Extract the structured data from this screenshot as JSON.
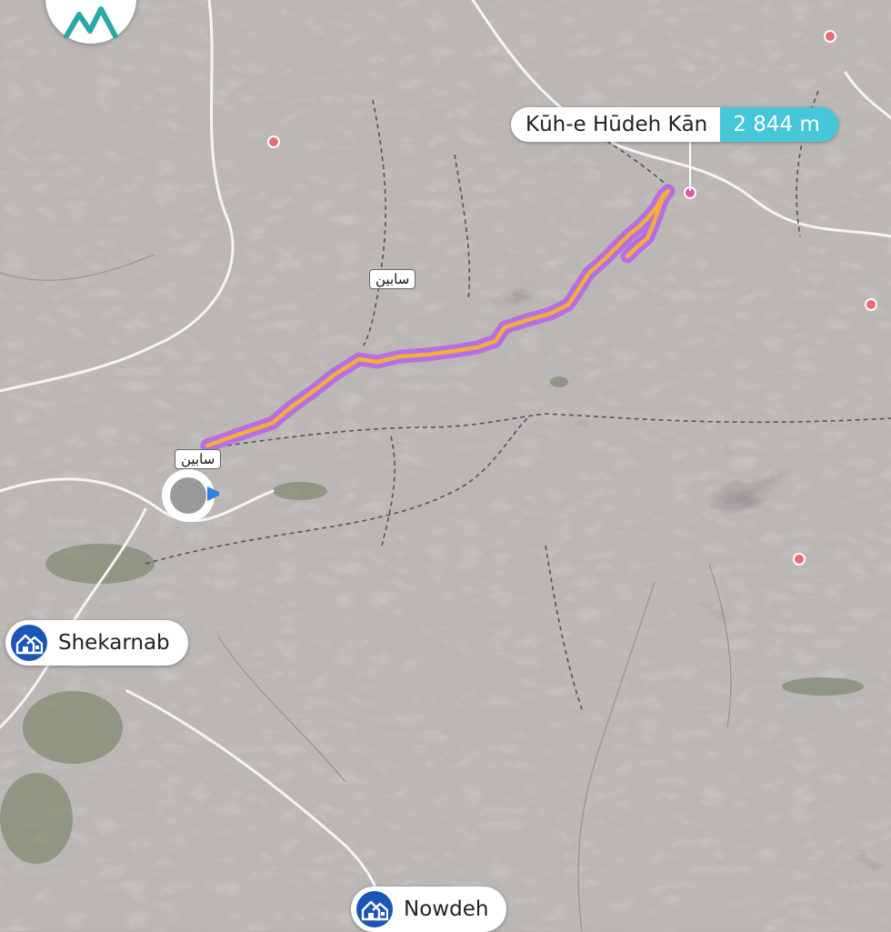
{
  "colors": {
    "terrain": "#b7b3b1",
    "route_outer": "#b56ae6",
    "route_inner": "#f2b03a",
    "elevation_badge": "#46c6d9",
    "place_icon_bg": "#1b55b7",
    "poi_dot": "#ea6b74",
    "peak_dot": "#e454a8",
    "location_arrow": "#2e7fe6",
    "location_dot": "#9a9a9a"
  },
  "app": {
    "logo_icon": "mountain-logo-icon"
  },
  "peak": {
    "name": "Kūh-e Hūdeh Kān",
    "elevation": "2 844 m"
  },
  "villages": [
    {
      "name": "سابین"
    },
    {
      "name": "سابین"
    }
  ],
  "places": [
    {
      "name": "Shekarnab",
      "icon": "village-icon"
    },
    {
      "name": "Nowdeh",
      "icon": "village-icon"
    }
  ],
  "user_location": {
    "icon": "location-heading-icon"
  }
}
